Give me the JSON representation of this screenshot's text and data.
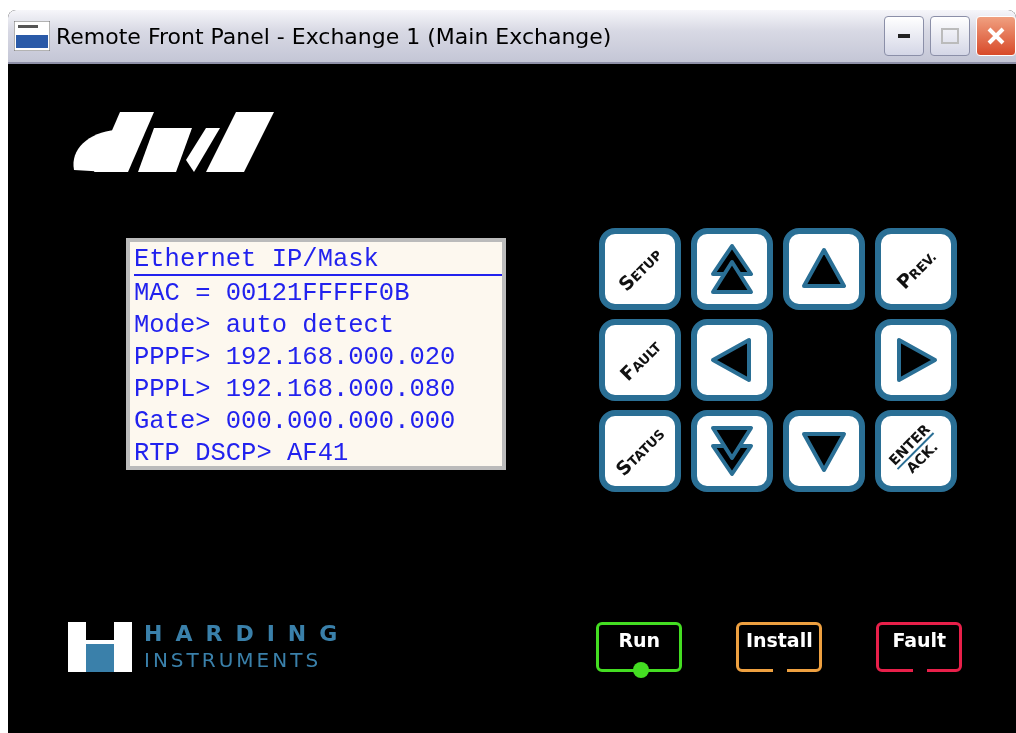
{
  "window": {
    "title": "Remote Front Panel - Exchange 1 (Main Exchange)"
  },
  "display": {
    "lines": [
      {
        "text": "Ethernet IP/Mask",
        "underlined": true
      },
      {
        "text": "MAC = 00121FFFFF0B",
        "underlined": false
      },
      {
        "text": "Mode> auto detect",
        "underlined": false
      },
      {
        "text": "PPPF> 192.168.000.020",
        "underlined": false
      },
      {
        "text": "PPPL> 192.168.000.080",
        "underlined": false
      },
      {
        "text": "Gate> 000.000.000.000",
        "underlined": false
      },
      {
        "text": "RTP DSCP> AF41",
        "underlined": false
      }
    ]
  },
  "keypad": {
    "rows": [
      [
        {
          "kind": "label",
          "label": "SETUP"
        },
        {
          "kind": "double-up"
        },
        {
          "kind": "up"
        },
        {
          "kind": "label",
          "label": "PREV."
        }
      ],
      [
        {
          "kind": "label",
          "label": "FAULT"
        },
        {
          "kind": "left"
        },
        {
          "kind": "empty"
        },
        {
          "kind": "right"
        }
      ],
      [
        {
          "kind": "label",
          "label": "STATUS"
        },
        {
          "kind": "double-down"
        },
        {
          "kind": "down"
        },
        {
          "kind": "split",
          "top": "ENTER",
          "bottom": "ACK."
        }
      ]
    ]
  },
  "brand": {
    "name": "HARDING",
    "subtitle": "INSTRUMENTS"
  },
  "indicators": [
    {
      "label": "Run",
      "color": "#44dd22",
      "on": true
    },
    {
      "label": "Install",
      "color": "#eea040",
      "on": false
    },
    {
      "label": "Fault",
      "color": "#e8204a",
      "on": false
    }
  ]
}
